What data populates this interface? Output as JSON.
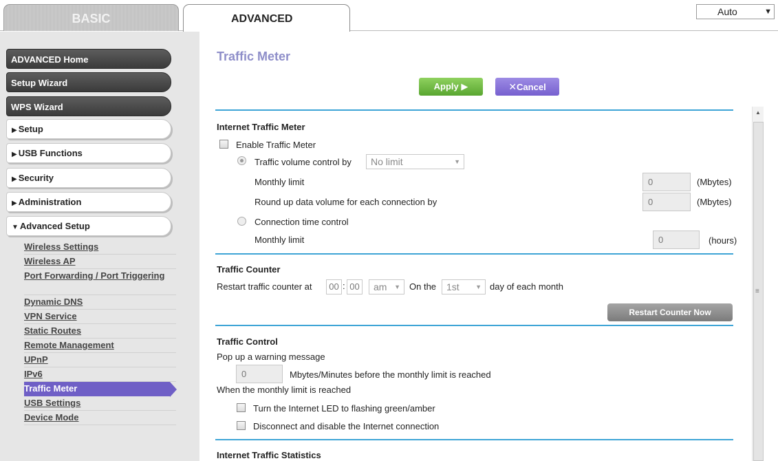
{
  "tabs": {
    "basic": "BASIC",
    "advanced": "ADVANCED"
  },
  "language_select": {
    "value": "Auto"
  },
  "sidebar": {
    "top_buttons": [
      "ADVANCED Home",
      "Setup Wizard",
      "WPS Wizard"
    ],
    "sections": [
      "Setup",
      "USB Functions",
      "Security",
      "Administration",
      "Advanced Setup"
    ],
    "advanced_items": [
      "Wireless Settings",
      "Wireless AP",
      "Port Forwarding / Port Triggering",
      "Dynamic DNS",
      "VPN Service",
      "Static Routes",
      "Remote Management",
      "UPnP",
      "IPv6",
      "Traffic Meter",
      "USB Settings",
      "Device Mode"
    ]
  },
  "main": {
    "title": "Traffic Meter",
    "apply_label": "Apply ▶",
    "cancel_label": "Cancel",
    "internet_meter": {
      "heading": "Internet Traffic Meter",
      "enable_label": "Enable Traffic Meter",
      "volume_label": "Traffic volume control by",
      "volume_value": "No limit",
      "monthly_limit_label": "Monthly limit",
      "monthly_limit_value": "0",
      "mbytes_unit": "(Mbytes)",
      "roundup_label": "Round up data volume for each connection by",
      "roundup_value": "0",
      "conn_time_label": "Connection time control",
      "time_limit_label": "Monthly limit",
      "time_limit_value": "0",
      "hours_unit": "(hours)"
    },
    "traffic_counter": {
      "heading": "Traffic Counter",
      "restart_label": "Restart traffic counter at",
      "hour": "00",
      "minute": "00",
      "ampm": "am",
      "on_the": "On the",
      "day": "1st",
      "day_suffix": "day of each month",
      "restart_now": "Restart Counter Now"
    },
    "traffic_control": {
      "heading": "Traffic Control",
      "popup_label": "Pop up a warning message",
      "warn_value": "0",
      "warn_suffix": "Mbytes/Minutes before the monthly limit is reached",
      "when_label": "When the monthly limit is reached",
      "led_label": "Turn the Internet LED to flashing green/amber",
      "disconnect_label": "Disconnect and disable the Internet connection"
    },
    "stats_heading": "Internet Traffic Statistics"
  }
}
